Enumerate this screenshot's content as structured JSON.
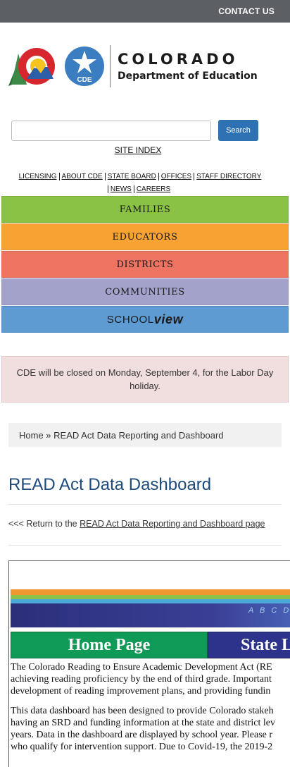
{
  "topbar": {
    "contact_label": "CONTACT US"
  },
  "logo": {
    "title": "COLORADO",
    "subtitle": "Department of Education",
    "badge": "CDE"
  },
  "search": {
    "placeholder": "",
    "button_label": "Search"
  },
  "site_index_label": "SITE INDEX",
  "quicklinks": [
    "LICENSING",
    "ABOUT CDE",
    "STATE BOARD",
    "OFFICES",
    "STAFF DIRECTORY",
    "NEWS",
    "CAREERS"
  ],
  "nav": {
    "families": "FAMILIES",
    "educators": "EDUCATORS",
    "districts": "DISTRICTS",
    "communities": "COMMUNITIES",
    "schoolview_a": "SCHOOL",
    "schoolview_b": "view"
  },
  "alert_text": "CDE will be closed on Monday, September 4, for the Labor Day holiday.",
  "breadcrumb": {
    "home": "Home",
    "separator": " » ",
    "current": "READ Act Data Reporting and Dashboard"
  },
  "page_title": "READ Act Data Dashboard",
  "return": {
    "prefix": "<<< Return to the ",
    "link": "READ Act Data Reporting and Dashboard page"
  },
  "embed": {
    "abc": "A B C D",
    "tab_home": "Home Page",
    "tab_state": "State L",
    "para1": [
      "The Colorado Reading to Ensure Academic Development Act (RE",
      "achieving reading proficiency by the end of third grade. Important",
      "development of reading improvement plans, and providing fundin"
    ],
    "para2": [
      "This data dashboard has been designed to provide Colorado stakeh",
      "having an SRD and funding information at the state and district lev",
      "years. Data in the dashboard are displayed by school year. Please r",
      "who qualify for intervention support. Due to Covid-19, the 2019-2"
    ]
  },
  "colors": {
    "topbar": "#5c5f63",
    "families": "#89c245",
    "educators": "#f7a233",
    "districts": "#ee7360",
    "communities": "#a3a2cb",
    "schoolview": "#5f9bd3",
    "search_button": "#2f72b4",
    "title": "#1d4a7a"
  }
}
